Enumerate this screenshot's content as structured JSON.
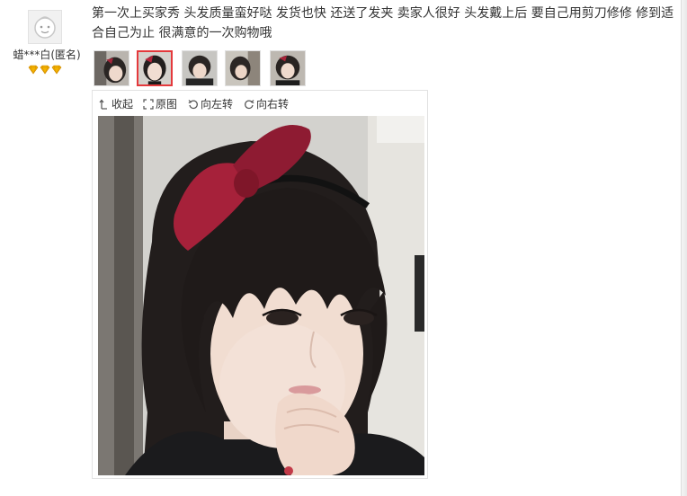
{
  "user": {
    "name": "蜡***白(匿名)",
    "level_icon": "diamond-icon",
    "level_count": 3
  },
  "review": {
    "text": "第一次上买家秀 头发质量蛮好哒 发货也快 还送了发夹 卖家人很好 头发戴上后 要自己用剪刀修修 修到适合自己为止 很满意的一次购物哦"
  },
  "thumbnails": {
    "count": 5,
    "active_index": 1
  },
  "viewer": {
    "toolbar": {
      "collapse_label": "收起",
      "original_label": "原图",
      "rotate_left_label": "向左转",
      "rotate_right_label": "向右转"
    }
  },
  "colors": {
    "accent": "#e4393c",
    "level_gem": "#f5b400"
  }
}
